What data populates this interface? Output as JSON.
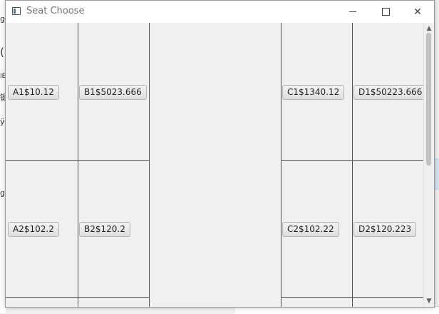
{
  "window": {
    "title": "Seat Choose"
  },
  "background_fragments": [
    "g",
    "(",
    "IE",
    "键",
    "ÿ",
    "g"
  ],
  "seats": [
    {
      "id": "A1",
      "label": "A1$10.12"
    },
    {
      "id": "B1",
      "label": "B1$5023.666"
    },
    {
      "id": "C1",
      "label": "C1$1340.12"
    },
    {
      "id": "D1",
      "label": "D1$50223.666"
    },
    {
      "id": "A2",
      "label": "A2$102.2"
    },
    {
      "id": "B2",
      "label": "B2$120.2"
    },
    {
      "id": "C2",
      "label": "C2$102.22"
    },
    {
      "id": "D2",
      "label": "D2$120.223"
    }
  ],
  "icons": {
    "minimize": "minimize-icon",
    "maximize": "maximize-icon",
    "close": "close-icon",
    "app": "app-icon"
  },
  "colors": {
    "grid_line": "#555555",
    "window_bg": "#f0f0f0"
  }
}
